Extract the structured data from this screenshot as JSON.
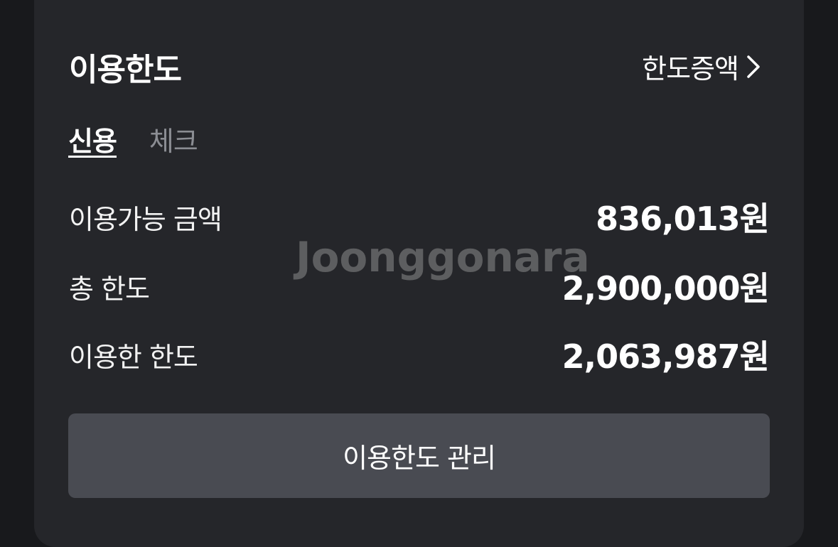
{
  "card": {
    "title": "이용한도",
    "increase_link": "한도증액",
    "increase_icon": "chevron-right-icon"
  },
  "tabs": [
    {
      "label": "신용",
      "active": true
    },
    {
      "label": "체크",
      "active": false
    }
  ],
  "rows": [
    {
      "label": "이용가능 금액",
      "value": "836,013원"
    },
    {
      "label": "총 한도",
      "value": "2,900,000원"
    },
    {
      "label": "이용한 한도",
      "value": "2,063,987원"
    }
  ],
  "watermark": "Joonggonara",
  "manage_button": "이용한도 관리"
}
